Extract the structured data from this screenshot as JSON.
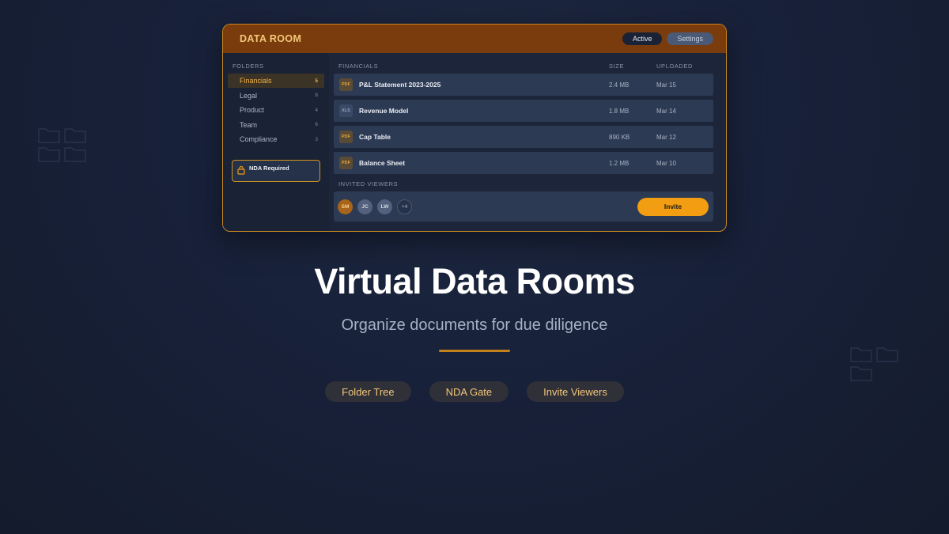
{
  "window": {
    "title": "DATA ROOM",
    "status_pill": "Active",
    "settings_pill": "Settings"
  },
  "sidebar": {
    "section_label": "FOLDERS",
    "folders": [
      {
        "name": "Financials",
        "count": "5"
      },
      {
        "name": "Legal",
        "count": "8"
      },
      {
        "name": "Product",
        "count": "4"
      },
      {
        "name": "Team",
        "count": "6"
      },
      {
        "name": "Compliance",
        "count": "3"
      }
    ],
    "nda": {
      "title": "NDA Required"
    }
  },
  "main": {
    "columns": {
      "name": "FINANCIALS",
      "size": "SIZE",
      "uploaded": "UPLOADED"
    },
    "files": [
      {
        "type": "PDF",
        "name": "P&L Statement 2023-2025",
        "size": "2.4 MB",
        "date": "Mar 15"
      },
      {
        "type": "XLS",
        "name": "Revenue Model",
        "size": "1.8 MB",
        "date": "Mar 14"
      },
      {
        "type": "PDF",
        "name": "Cap Table",
        "size": "890 KB",
        "date": "Mar 12"
      },
      {
        "type": "PDF",
        "name": "Balance Sheet",
        "size": "1.2 MB",
        "date": "Mar 10"
      }
    ],
    "viewers_label": "INVITED VIEWERS",
    "viewers": [
      "SM",
      "JC",
      "LW",
      "+4"
    ],
    "invite_label": "Invite"
  },
  "hero": {
    "title": "Virtual Data Rooms",
    "subtitle": "Organize documents for due diligence"
  },
  "chips": [
    "Folder Tree",
    "NDA Gate",
    "Invite Viewers"
  ],
  "colors": {
    "accent": "#f29d12",
    "titlebar": "#7a3c0c",
    "border": "#c9861f"
  }
}
